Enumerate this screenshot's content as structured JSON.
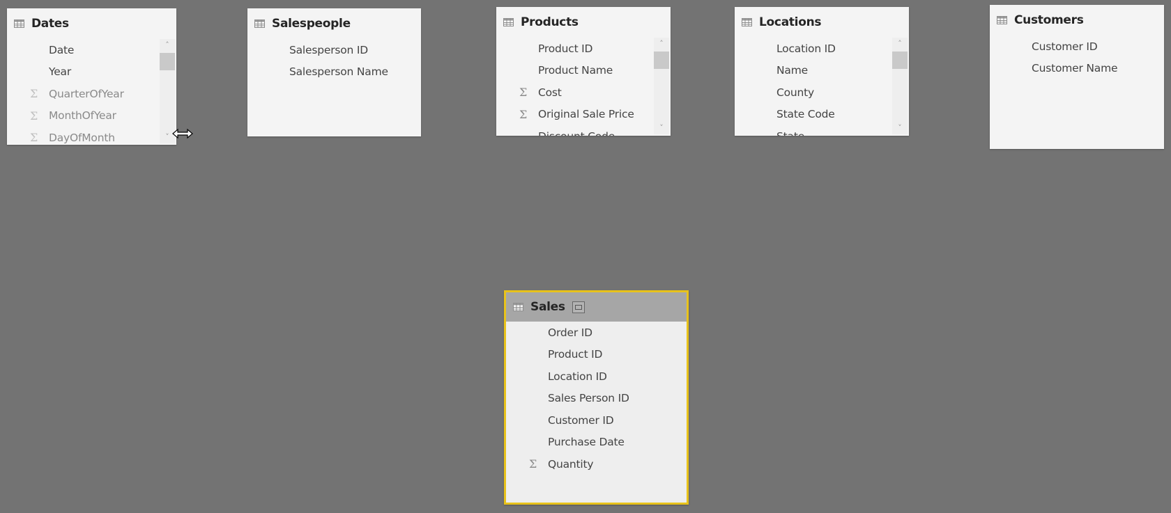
{
  "tables": {
    "dates": {
      "title": "Dates",
      "fields": [
        {
          "label": "Date",
          "sigma": false,
          "dim": false
        },
        {
          "label": "Year",
          "sigma": false,
          "dim": false
        },
        {
          "label": "QuarterOfYear",
          "sigma": true,
          "dim": true
        },
        {
          "label": "MonthOfYear",
          "sigma": true,
          "dim": true
        },
        {
          "label": "DayOfMonth",
          "sigma": true,
          "dim": true
        }
      ]
    },
    "salespeople": {
      "title": "Salespeople",
      "fields": [
        {
          "label": "Salesperson ID",
          "sigma": false
        },
        {
          "label": "Salesperson Name",
          "sigma": false
        }
      ]
    },
    "products": {
      "title": "Products",
      "fields": [
        {
          "label": "Product ID",
          "sigma": false
        },
        {
          "label": "Product Name",
          "sigma": false
        },
        {
          "label": "Cost",
          "sigma": true
        },
        {
          "label": "Original Sale Price",
          "sigma": true
        },
        {
          "label": "Discount Code",
          "sigma": false
        }
      ]
    },
    "locations": {
      "title": "Locations",
      "fields": [
        {
          "label": "Location ID",
          "sigma": false
        },
        {
          "label": "Name",
          "sigma": false
        },
        {
          "label": "County",
          "sigma": false
        },
        {
          "label": "State Code",
          "sigma": false
        },
        {
          "label": "State",
          "sigma": false
        }
      ]
    },
    "customers": {
      "title": "Customers",
      "fields": [
        {
          "label": "Customer ID",
          "sigma": false
        },
        {
          "label": "Customer Name",
          "sigma": false
        }
      ]
    },
    "sales": {
      "title": "Sales",
      "selected": true,
      "fields": [
        {
          "label": "Order ID",
          "sigma": false
        },
        {
          "label": "Product ID",
          "sigma": false
        },
        {
          "label": "Location ID",
          "sigma": false
        },
        {
          "label": "Sales Person ID",
          "sigma": false
        },
        {
          "label": "Customer ID",
          "sigma": false
        },
        {
          "label": "Purchase Date",
          "sigma": false
        },
        {
          "label": "Quantity",
          "sigma": true
        }
      ]
    }
  },
  "icons": {
    "sigma": "Σ",
    "scroll_up": "⌃",
    "scroll_down": "⌄"
  },
  "colors": {
    "canvas": "#737373",
    "card": "#f4f4f4",
    "selected_border": "#e8c21b",
    "selected_header": "#a6a6a6"
  }
}
